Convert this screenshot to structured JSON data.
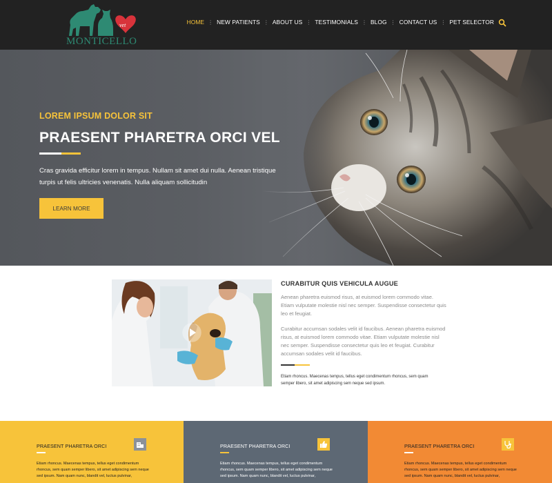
{
  "header": {
    "logo_text": "MONTICELLO",
    "nav": [
      {
        "label": "HOME",
        "active": true
      },
      {
        "label": "NEW PATIENTS",
        "active": false
      },
      {
        "label": "ABOUT US",
        "active": false
      },
      {
        "label": "TESTIMONIALS",
        "active": false
      },
      {
        "label": "BLOG",
        "active": false
      },
      {
        "label": "CONTACT US",
        "active": false
      },
      {
        "label": "PET SELECTOR",
        "active": false
      }
    ],
    "search_icon": "search-icon"
  },
  "hero": {
    "eyebrow": "LOREM IPSUM DOLOR SIT",
    "title": "PRAESENT PHARETRA ORCI VEL",
    "text": "Cras gravida efficitur lorem in tempus. Nullam sit amet dui nulla. Aenean tristique turpis ut felis ultricies venenatis. Nulla aliquam sollicitudin",
    "button": "LEARN MORE"
  },
  "about": {
    "title": "CURABITUR QUIS VEHICULA AUGUE",
    "p1": "Aenean pharetra euismod risus, at euismod lorem commodo vitae. Etiam vulputate molestie nisl nec semper. Suspendisse consectetur quis leo et feugiat.",
    "p2": "Curabitur accumsan sodales velit id faucibus. Aenean pharetra euismod risus, at euismod lorem commodo vitae. Etiam vulputate molestie nisl nec semper. Suspendisse consectetur quis leo et feugiat. Curabitur accumsan sodales velit id faucibus.",
    "p3": "Etiam rhoncus. Maecenas tempus, tellus eget condimentum rhoncus, sem quam semper libero, sit amet adipiscing sem neque sed ipsum."
  },
  "panels": [
    {
      "title": "PRAESENT PHARETRA ORCI",
      "text": "Etiam rhoncus. Maecenas tempus, tellus eget condimentum rhoncus, sem quam semper libero, sit amet adipiscing sem neque sed ipsum. Nam quam nunc, blandit vel, luctus pulvinar,",
      "bg": "#f7c33a",
      "icon": "building-icon"
    },
    {
      "title": "PRAESENT PHARETRA ORCI",
      "text": "Etiam rhoncus. Maecenas tempus, tellus eget condimentum rhoncus, sem quam semper libero, sit amet adipiscing sem neque sed ipsum. Nam quam nunc, blandit vel, luctus pulvinar,",
      "bg": "#5d6874",
      "icon": "thumbs-up-icon"
    },
    {
      "title": "PRAESENT PHARETRA ORCI",
      "text": "Etiam rhoncus. Maecenas tempus, tellus eget condimentum rhoncus, sem quam semper libero, sit amet adipiscing sem neque sed ipsum. Nam quam nunc, blandit vel, luctus pulvinar,",
      "bg": "#f28a34",
      "icon": "stethoscope-icon"
    }
  ],
  "colors": {
    "accent": "#f7c33a",
    "header_bg": "#222222",
    "logo_green": "#2e8a73",
    "logo_red": "#d8333b"
  }
}
